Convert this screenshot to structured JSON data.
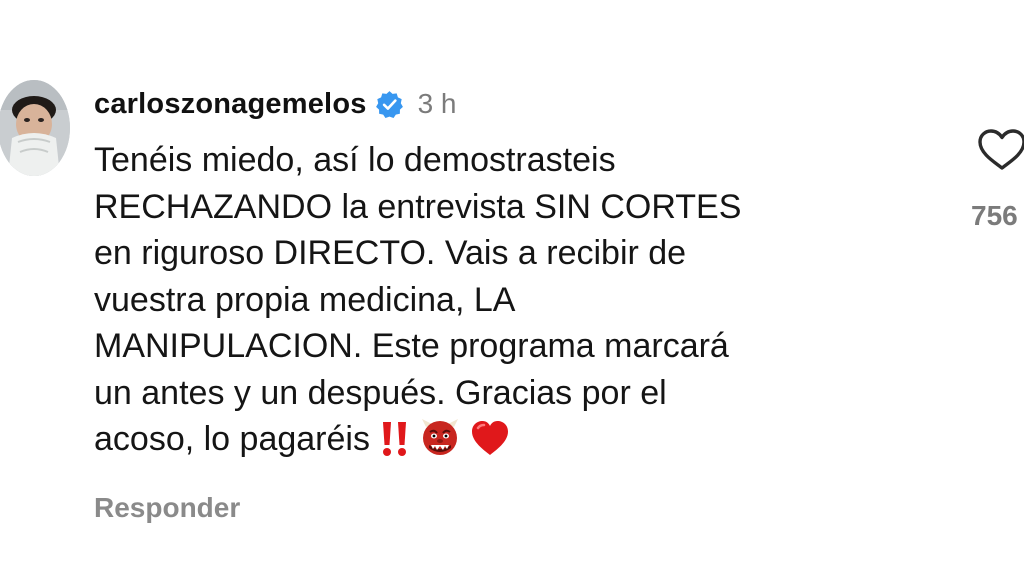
{
  "comment": {
    "username": "carloszonagemelos",
    "verified_icon": "verified-badge-icon",
    "time_ago": "3 h",
    "lines": [
      "Tenéis miedo, así lo demostrasteis",
      "RECHAZANDO la entrevista SIN CORTES",
      "en riguroso DIRECTO. Vais a recibir de",
      "vuestra propia medicina, LA",
      "MANIPULACION. Este programa marcará",
      "un antes y un después. Gracias por el",
      "acoso, lo pagaréis"
    ],
    "emojis": [
      "double-exclamation-emoji",
      "ogre-emoji",
      "red-heart-emoji"
    ],
    "reply_label": "Responder",
    "like_count": "756",
    "like_icon": "heart-outline-icon"
  },
  "colors": {
    "verified_blue": "#3897f0",
    "muted_text": "#8a8a8a",
    "emoji_red": "#e0181b"
  }
}
